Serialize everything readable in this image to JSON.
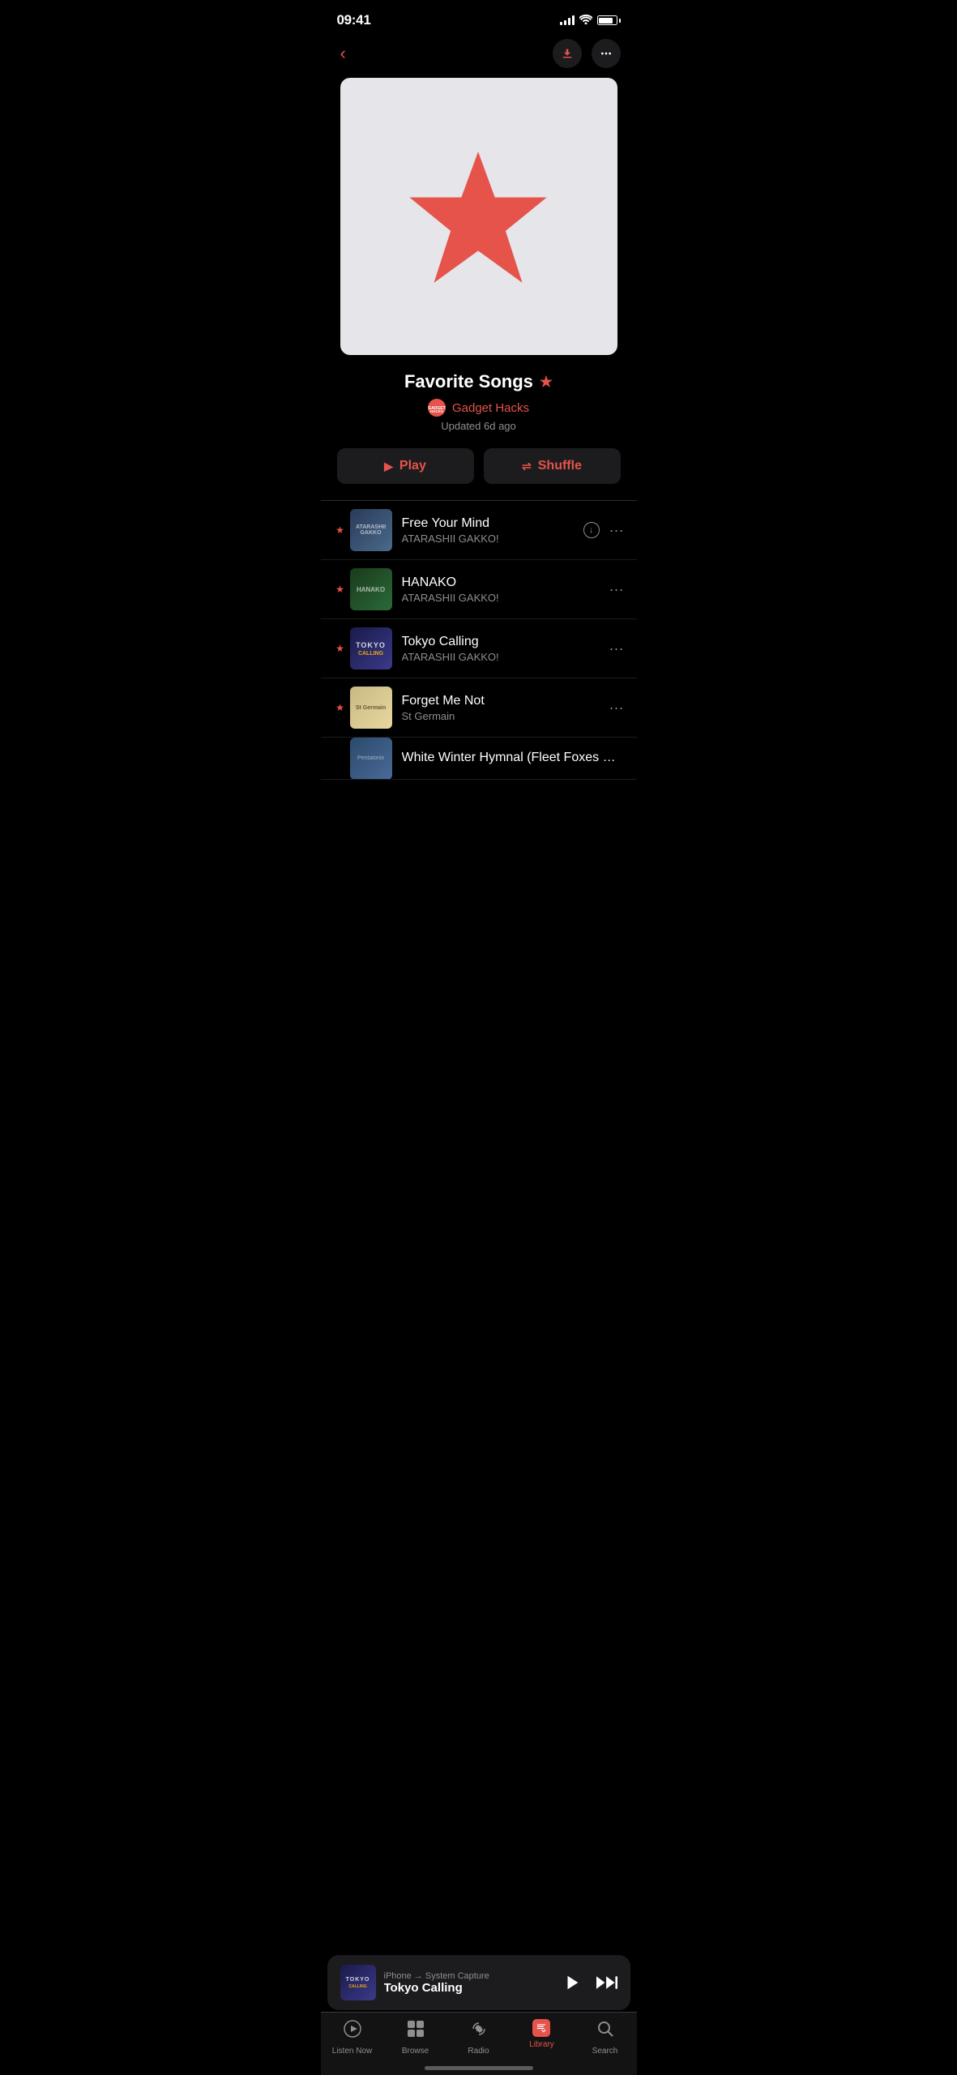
{
  "statusBar": {
    "time": "09:41"
  },
  "navigation": {
    "backLabel": "‹",
    "downloadLabel": "↓",
    "moreLabel": "···"
  },
  "playlist": {
    "title": "Favorite Songs",
    "titleStar": "★",
    "authorName": "Gadget Hacks",
    "authorAvatarText": "GADGET HACKS",
    "updatedText": "Updated 6d ago",
    "playLabel": "Play",
    "shuffleLabel": "Shuffle"
  },
  "songs": [
    {
      "id": 1,
      "title": "Free Your Mind",
      "artist": "ATARASHII GAKKO!",
      "starred": true,
      "hasDownload": true,
      "thumbClass": "thumb-ag-next"
    },
    {
      "id": 2,
      "title": "HANAKO",
      "artist": "ATARASHII GAKKO!",
      "starred": true,
      "hasDownload": false,
      "thumbClass": "thumb-hanako"
    },
    {
      "id": 3,
      "title": "Tokyo Calling",
      "artist": "ATARASHII GAKKO!",
      "starred": true,
      "hasDownload": false,
      "thumbClass": "thumb-tokyo"
    },
    {
      "id": 4,
      "title": "Forget Me Not",
      "artist": "St Germain",
      "starred": true,
      "hasDownload": false,
      "thumbClass": "thumb-forget"
    },
    {
      "id": 5,
      "title": "White Winter Hymnal (Fleet Foxes Cover)",
      "artist": "",
      "starred": false,
      "hasDownload": false,
      "thumbClass": "thumb-white"
    }
  ],
  "miniPlayer": {
    "source": "iPhone → System Capture",
    "title": "Tokyo Calling"
  },
  "tabBar": {
    "items": [
      {
        "id": "listen-now",
        "label": "Listen Now",
        "icon": "▶",
        "active": false
      },
      {
        "id": "browse",
        "label": "Browse",
        "icon": "⊞",
        "active": false
      },
      {
        "id": "radio",
        "label": "Radio",
        "icon": "((·))",
        "active": false
      },
      {
        "id": "library",
        "label": "Library",
        "icon": "library",
        "active": true
      },
      {
        "id": "search",
        "label": "Search",
        "icon": "🔍",
        "active": false
      }
    ]
  }
}
